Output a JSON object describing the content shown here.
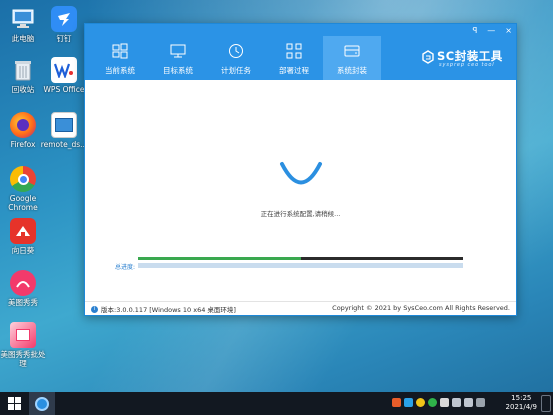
{
  "desktop": {
    "icons": [
      {
        "label": "此电脑"
      },
      {
        "label": "钉钉"
      },
      {
        "label": "回收站"
      },
      {
        "label": "WPS Office"
      },
      {
        "label": "Firefox"
      },
      {
        "label": "remote_ds..."
      },
      {
        "label": "Google\nChrome"
      },
      {
        "label": "向日葵"
      },
      {
        "label": "美图秀秀"
      },
      {
        "label": "美图秀秀批处\n理"
      }
    ]
  },
  "window": {
    "controls": {
      "user": "ꟼ",
      "minimize": "—",
      "close": "×"
    },
    "tabs": [
      {
        "label": "当前系统",
        "icon": "windows-icon"
      },
      {
        "label": "目标系统",
        "icon": "monitor-icon"
      },
      {
        "label": "计划任务",
        "icon": "clock-icon"
      },
      {
        "label": "部署过程",
        "icon": "grid-icon"
      },
      {
        "label": "系统封装",
        "icon": "drive-icon"
      }
    ],
    "active_tab": 4,
    "logo": {
      "brand": "SC封装工具",
      "sub": "sysprep ceo tool"
    },
    "status_text": "正在进行系统配置,请稍候...",
    "progress": {
      "current": 0.5,
      "total_label": "总进度:",
      "total": 0
    },
    "footer": {
      "version": "版本:3.0.0.117 [Windows 10 x64 桌面环境]",
      "copyright": "Copyright © 2021 by SysCeo.com All Rights Reserved."
    }
  },
  "taskbar": {
    "time": "15:25",
    "date": "2021/4/9"
  },
  "colors": {
    "accent": "#2b93e6",
    "active_tab": "#4fa9f0",
    "progress_green": "#3aa84f"
  }
}
